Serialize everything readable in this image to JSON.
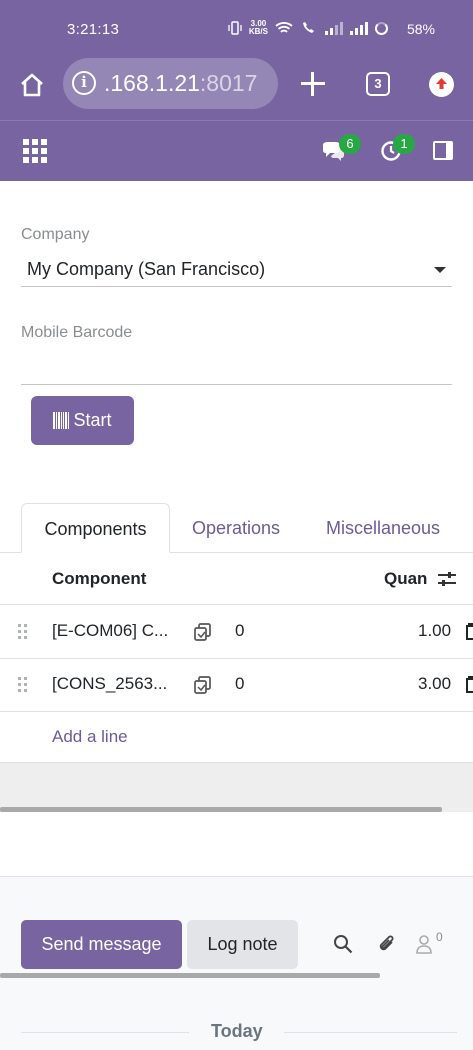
{
  "status_bar": {
    "time": "3:21:13",
    "speed_value": "3.00",
    "speed_unit": "KB/S",
    "battery": "58%"
  },
  "browser": {
    "url_host": ".168.1.21",
    "url_port": ":8017",
    "tab_count": "3"
  },
  "odoo_nav": {
    "messages_count": "6",
    "activities_count": "1"
  },
  "form": {
    "company_label": "Company",
    "company_value": "My Company (San Francisco)",
    "barcode_label": "Mobile Barcode",
    "barcode_value": "",
    "start_button": "Start"
  },
  "notebook": {
    "tabs": [
      {
        "label": "Components",
        "active": true
      },
      {
        "label": "Operations",
        "active": false
      },
      {
        "label": "Miscellaneous",
        "active": false
      }
    ]
  },
  "components_table": {
    "headers": {
      "component": "Component",
      "quantity": "Quan"
    },
    "rows": [
      {
        "component": "[E-COM06] C...",
        "availability": "0",
        "quantity": "1.00"
      },
      {
        "component": "[CONS_2563...",
        "availability": "0",
        "quantity": "3.00"
      }
    ],
    "add_line": "Add a line"
  },
  "chatter": {
    "send_message": "Send message",
    "log_note": "Log note",
    "followers_count": "0",
    "date_separator": "Today"
  },
  "colors": {
    "brand": "#7764a0",
    "link": "#6c5b96",
    "badge": "#28a745"
  }
}
